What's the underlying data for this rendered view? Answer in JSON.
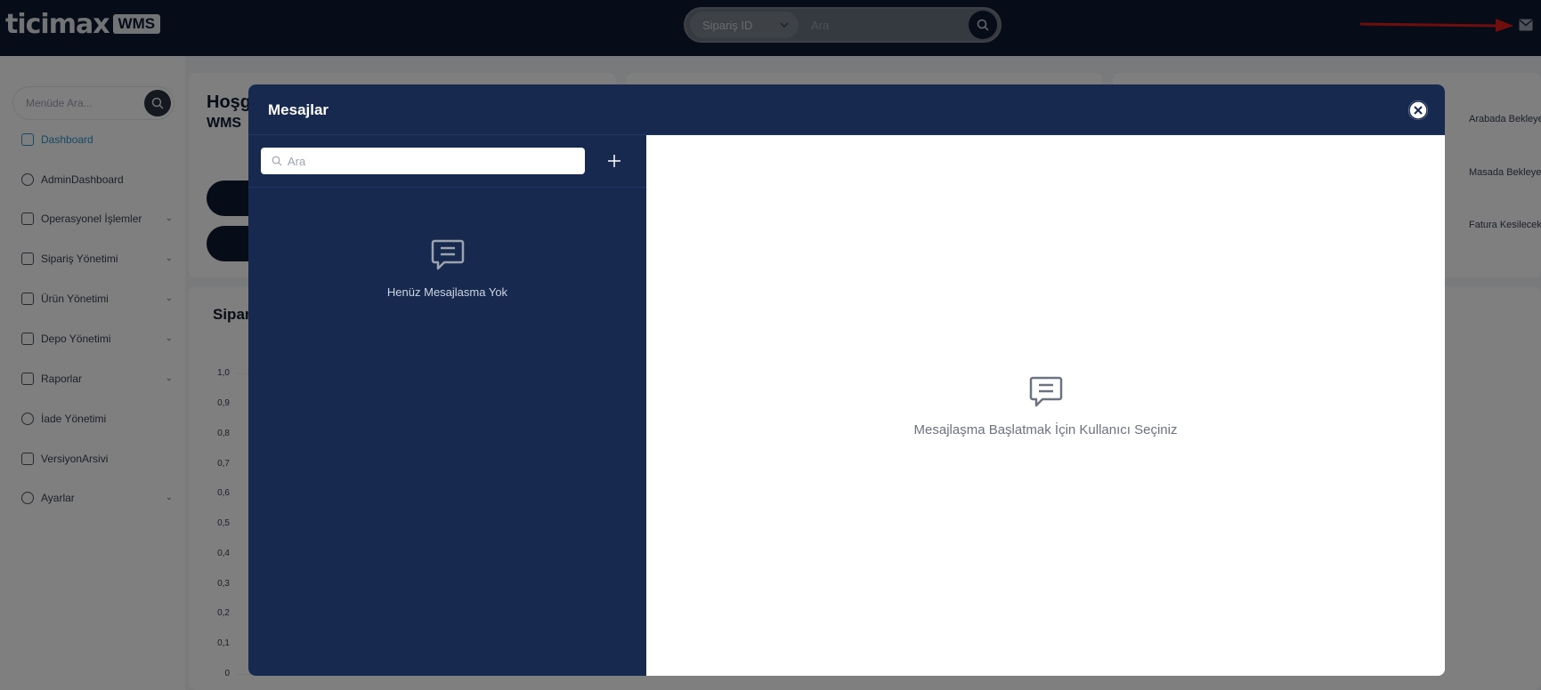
{
  "topbar": {
    "logo_text": "ticimax",
    "logo_badge": "WMS",
    "search": {
      "select_value": "Sipariş ID",
      "placeholder": "Ara"
    }
  },
  "sidebar": {
    "search_placeholder": "Menüde Ara...",
    "items": [
      {
        "label": "Dashboard",
        "active": true,
        "has_chevron": false
      },
      {
        "label": "AdminDashboard",
        "has_chevron": false
      },
      {
        "label": "Operasyonel İşlemler",
        "has_chevron": true
      },
      {
        "label": "Sipariş Yönetimi",
        "has_chevron": true
      },
      {
        "label": "Ürün Yönetimi",
        "has_chevron": true
      },
      {
        "label": "Depo Yönetimi",
        "has_chevron": true
      },
      {
        "label": "Raporlar",
        "has_chevron": true
      },
      {
        "label": "İade Yönetimi",
        "has_chevron": false
      },
      {
        "label": "VersiyonArsivi",
        "has_chevron": false
      },
      {
        "label": "Ayarlar",
        "has_chevron": true
      }
    ]
  },
  "dashboard": {
    "greeting": "Hoşg",
    "greeting_sub": "WMS",
    "chart_title": "Sipar",
    "y_ticks": [
      "1,0",
      "0,9",
      "0,8",
      "0,7",
      "0,6",
      "0,5",
      "0,4",
      "0,3",
      "0,2",
      "0,1",
      "0"
    ],
    "right_cards": [
      "Arabada Bekleye",
      "Masada Bekleye",
      "Fatura Kesilecek"
    ]
  },
  "modal": {
    "title": "Mesajlar",
    "search_placeholder": "Ara",
    "empty_list_text": "Henüz Mesajlasma Yok",
    "empty_chat_text": "Mesajlaşma Başlatmak İçin Kullanıcı Seçiniz"
  },
  "colors": {
    "navy": "#0e1a31",
    "modal_navy": "#18294f",
    "accent": "#2b93c9",
    "arrow": "#e11d1d"
  }
}
